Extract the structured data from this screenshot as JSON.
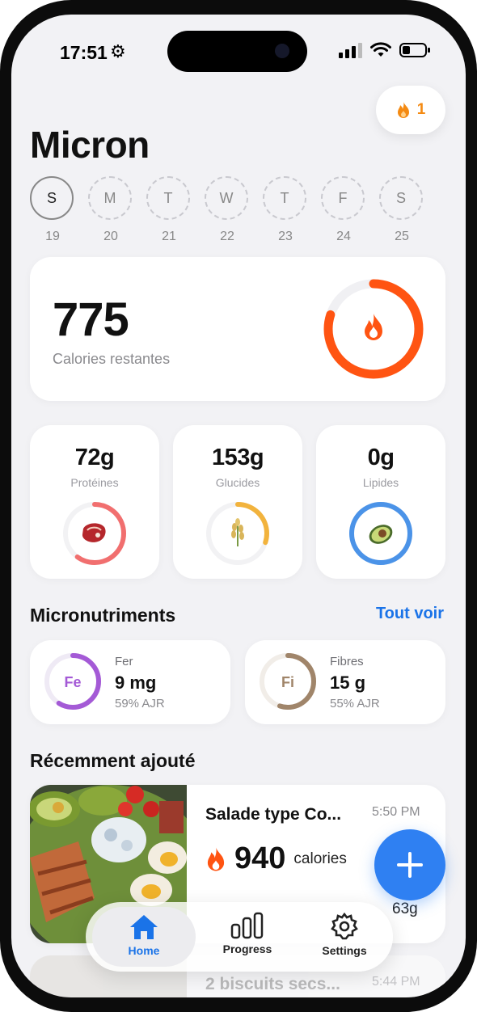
{
  "status": {
    "time": "17:51"
  },
  "streak": {
    "count": "1",
    "icon": "flame-icon",
    "color": "#f48a12"
  },
  "app": {
    "title": "Micron"
  },
  "week": [
    {
      "letter": "S",
      "day": "19",
      "active": true
    },
    {
      "letter": "M",
      "day": "20",
      "active": false
    },
    {
      "letter": "T",
      "day": "21",
      "active": false
    },
    {
      "letter": "W",
      "day": "22",
      "active": false
    },
    {
      "letter": "T",
      "day": "23",
      "active": false
    },
    {
      "letter": "F",
      "day": "24",
      "active": false
    },
    {
      "letter": "S",
      "day": "25",
      "active": false
    }
  ],
  "calories": {
    "value": "775",
    "label": "Calories restantes",
    "ring_fraction": 0.8,
    "color": "#ff5412"
  },
  "macros": [
    {
      "value": "72g",
      "label": "Protéines",
      "icon": "steak-icon",
      "color": "#f16f6f",
      "fraction": 0.6
    },
    {
      "value": "153g",
      "label": "Glucides",
      "icon": "rice-icon",
      "color": "#f2b33d",
      "fraction": 0.3
    },
    {
      "value": "0g",
      "label": "Lipides",
      "icon": "avocado-icon",
      "color": "#4b93e8",
      "fraction": 1.0
    }
  ],
  "micronutrients": {
    "title": "Micronutriments",
    "see_all": "Tout voir",
    "items": [
      {
        "symbol": "Fe",
        "name": "Fer",
        "amount": "9 mg",
        "pct": "59% AJR",
        "color": "#a45ad6",
        "fraction": 0.59
      },
      {
        "symbol": "Fi",
        "name": "Fibres",
        "amount": "15 g",
        "pct": "55% AJR",
        "color": "#a0856a",
        "fraction": 0.55
      }
    ]
  },
  "recent": {
    "title": "Récemment ajouté",
    "items": [
      {
        "name": "Salade type Co...",
        "time": "5:50 PM",
        "calories": "940",
        "unit": "calories",
        "macro_value": "63g"
      },
      {
        "name": "2 biscuits secs...",
        "time": "5:44 PM"
      }
    ]
  },
  "nav": {
    "home": "Home",
    "progress": "Progress",
    "settings": "Settings",
    "accent": "#1a73e8"
  }
}
